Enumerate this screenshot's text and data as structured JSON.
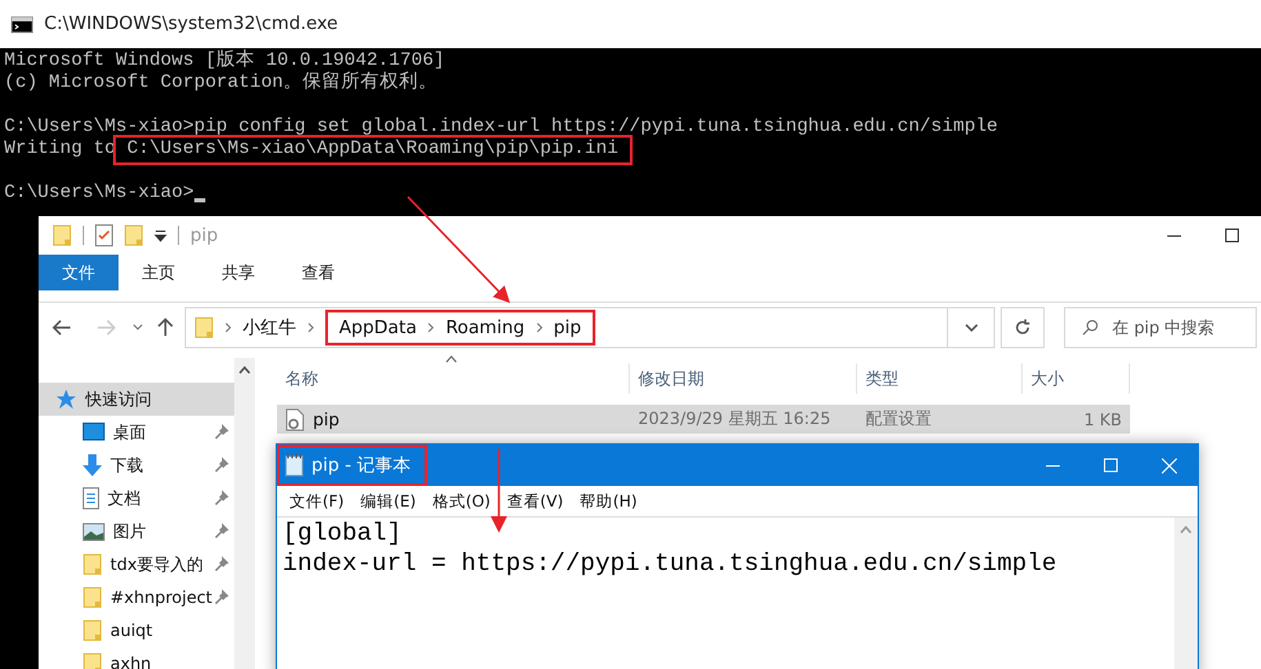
{
  "cmd": {
    "title": "C:\\WINDOWS\\system32\\cmd.exe",
    "lines": [
      {
        "kind": "text",
        "text": "Microsoft Windows [版本 10.0.19042.1706]"
      },
      {
        "kind": "text",
        "text": "(c) Microsoft Corporation。保留所有权利。"
      },
      {
        "kind": "blank"
      },
      {
        "kind": "text",
        "text": "C:\\Users\\Ms-xiao>pip config set global.index-url https://pypi.tuna.tsinghua.edu.cn/simple"
      },
      {
        "kind": "text",
        "text": "Writing to",
        "boxed": "C:\\Users\\Ms-xiao\\AppData\\Roaming\\pip\\pip.ini"
      },
      {
        "kind": "blank"
      },
      {
        "kind": "text",
        "text": "C:\\Users\\Ms-xiao>",
        "cursor": true
      }
    ]
  },
  "explorer": {
    "title": "pip",
    "ribbon_tabs": [
      {
        "label": "文件",
        "selected": true
      },
      {
        "label": "主页",
        "selected": false
      },
      {
        "label": "共享",
        "selected": false
      },
      {
        "label": "查看",
        "selected": false
      }
    ],
    "breadcrumb": {
      "plain": [
        "小红牛"
      ],
      "boxed": [
        "AppData",
        "Roaming",
        "pip"
      ]
    },
    "search": {
      "placeholder": "在 pip 中搜索"
    },
    "sidebar": {
      "items": [
        {
          "label": "快速访问",
          "kind": "star",
          "selected": true,
          "pinned": false
        },
        {
          "label": "桌面",
          "kind": "desktop",
          "selected": false,
          "pinned": true
        },
        {
          "label": "下载",
          "kind": "download",
          "selected": false,
          "pinned": true
        },
        {
          "label": "文档",
          "kind": "document",
          "selected": false,
          "pinned": true
        },
        {
          "label": "图片",
          "kind": "picture",
          "selected": false,
          "pinned": true
        },
        {
          "label": "tdx要导入的",
          "kind": "folder",
          "selected": false,
          "pinned": true
        },
        {
          "label": "#xhnproject",
          "kind": "folder",
          "selected": false,
          "pinned": true
        },
        {
          "label": "auiqt",
          "kind": "folder",
          "selected": false,
          "pinned": false
        },
        {
          "label": "axhn",
          "kind": "folder",
          "selected": false,
          "pinned": false
        }
      ]
    },
    "table": {
      "columns": [
        "名称",
        "修改日期",
        "类型",
        "大小"
      ],
      "rows": [
        {
          "name": "pip",
          "modified": "2023/9/29 星期五 16:25",
          "type": "配置设置",
          "size": "1 KB",
          "selected": true
        }
      ]
    }
  },
  "notepad": {
    "title": "pip - 记事本",
    "title_boxed": true,
    "menu": [
      "文件(F)",
      "编辑(E)",
      "格式(O)",
      "查看(V)",
      "帮助(H)"
    ],
    "lines": [
      "[global]",
      "index-url = https://pypi.tuna.tsinghua.edu.cn/simple"
    ]
  }
}
